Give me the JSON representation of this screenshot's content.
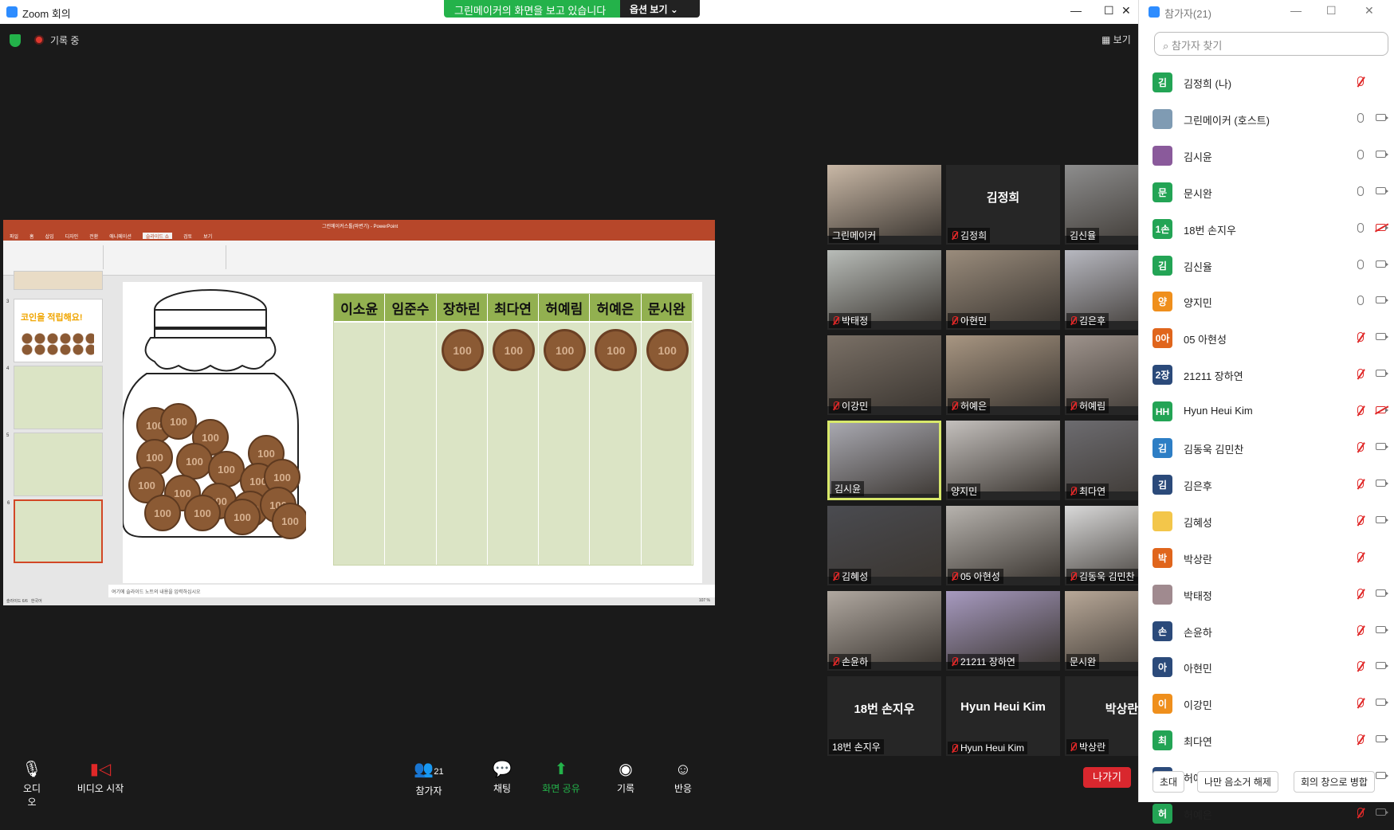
{
  "window": {
    "title": "Zoom 회의",
    "sharing_msg": "그린메이커의 화면을 보고 있습니다",
    "options_label": "옵션 보기"
  },
  "recording": "기록 중",
  "view_label": "보기",
  "ppt": {
    "title": "그린메이커스톨(마변기) - PowerPoint",
    "tabs": [
      "파일",
      "홈",
      "삽입",
      "디자인",
      "전환",
      "애니메이션",
      "슬라이드 쇼",
      "검토",
      "보기"
    ],
    "active_tab": "슬라이드 쇼",
    "slide_titles": {
      "s3": "코인을 적립해요!"
    },
    "notes_placeholder": "여기에 슬라이드 노트의 내용을 입력하십시오",
    "status_left": "슬라이드 6/6",
    "status_lang": "한국어",
    "zoom": "107 %"
  },
  "table_headers": [
    "이소윤",
    "임준수",
    "장하린",
    "최다연",
    "허예림",
    "허예은",
    "문시완"
  ],
  "coin_label": "100",
  "tiles": [
    {
      "name": "그린메이커",
      "muted": false
    },
    {
      "name": "김정희",
      "big": "김정희",
      "muted": true
    },
    {
      "name": "김신율",
      "muted": false
    },
    {
      "name": "박태정",
      "muted": true
    },
    {
      "name": "아현민",
      "muted": true
    },
    {
      "name": "김은후",
      "muted": true
    },
    {
      "name": "이강민",
      "muted": true
    },
    {
      "name": "허예은",
      "muted": true
    },
    {
      "name": "허예림",
      "muted": true
    },
    {
      "name": "김시윤",
      "muted": false
    },
    {
      "name": "양지민",
      "muted": false
    },
    {
      "name": "최다연",
      "muted": true
    },
    {
      "name": "김혜성",
      "muted": true
    },
    {
      "name": "05 아현성",
      "muted": true
    },
    {
      "name": "김동욱 김민찬",
      "muted": true
    },
    {
      "name": "손윤하",
      "muted": true
    },
    {
      "name": "21211 장하연",
      "muted": true
    },
    {
      "name": "문시완",
      "muted": false
    },
    {
      "name": "18번 손지우",
      "big": "18번 손지우",
      "muted": false
    },
    {
      "name": "Hyun Heui Kim",
      "big": "Hyun Heui Kim",
      "muted": true
    },
    {
      "name": "박상란",
      "big": "박상란",
      "muted": true
    }
  ],
  "toolbar": {
    "audio": "오디오",
    "video": "비디오 시작",
    "participants": "참가자",
    "participants_count": "21",
    "chat": "채팅",
    "share": "화면 공유",
    "record": "기록",
    "reactions": "반응",
    "leave": "나가기"
  },
  "panel": {
    "title": "참가자(21)",
    "search_placeholder": "참가자 찾기",
    "participants": [
      {
        "initial": "김",
        "name": "김정희 (나)",
        "color": "#23a455",
        "mic": "off",
        "cam": "none"
      },
      {
        "initial": "",
        "name": "그린메이커 (호스트)",
        "color": "#7f9bb3",
        "mic": "on",
        "cam": "on"
      },
      {
        "initial": "",
        "name": "김시윤",
        "color": "#8a5a9b",
        "mic": "on",
        "cam": "on"
      },
      {
        "initial": "문",
        "name": "문시완",
        "color": "#23a455",
        "mic": "on",
        "cam": "on"
      },
      {
        "initial": "1손",
        "name": "18번 손지우",
        "color": "#23a455",
        "mic": "on",
        "cam": "off"
      },
      {
        "initial": "김",
        "name": "김신율",
        "color": "#23a455",
        "mic": "on",
        "cam": "on"
      },
      {
        "initial": "양",
        "name": "양지민",
        "color": "#ef8f1c",
        "mic": "on",
        "cam": "on"
      },
      {
        "initial": "0아",
        "name": "05 아현성",
        "color": "#e0651c",
        "mic": "off",
        "cam": "on"
      },
      {
        "initial": "2장",
        "name": "21211 장하연",
        "color": "#2b4a7a",
        "mic": "off",
        "cam": "on"
      },
      {
        "initial": "HH",
        "name": "Hyun Heui Kim",
        "color": "#23a455",
        "mic": "off",
        "cam": "off"
      },
      {
        "initial": "김",
        "name": "김동욱 김민찬",
        "color": "#2d7ec5",
        "mic": "off",
        "cam": "on"
      },
      {
        "initial": "김",
        "name": "김은후",
        "color": "#2b4a7a",
        "mic": "off",
        "cam": "on"
      },
      {
        "initial": "",
        "name": "김혜성",
        "color": "#f3c64a",
        "mic": "off",
        "cam": "on"
      },
      {
        "initial": "박",
        "name": "박상란",
        "color": "#e0651c",
        "mic": "off",
        "cam": "none"
      },
      {
        "initial": "",
        "name": "박태정",
        "color": "#a08a8f",
        "mic": "off",
        "cam": "on"
      },
      {
        "initial": "손",
        "name": "손윤하",
        "color": "#2b4a7a",
        "mic": "off",
        "cam": "on"
      },
      {
        "initial": "아",
        "name": "아현민",
        "color": "#2b4a7a",
        "mic": "off",
        "cam": "on"
      },
      {
        "initial": "이",
        "name": "이강민",
        "color": "#ef8f1c",
        "mic": "off",
        "cam": "on"
      },
      {
        "initial": "최",
        "name": "최다연",
        "color": "#23a455",
        "mic": "off",
        "cam": "on"
      },
      {
        "initial": "허",
        "name": "허예림",
        "color": "#2b4a7a",
        "mic": "off",
        "cam": "on"
      },
      {
        "initial": "허",
        "name": "허예은",
        "color": "#23a455",
        "mic": "off",
        "cam": "on"
      }
    ],
    "footer": {
      "invite": "초대",
      "unmute_me": "나만 음소거 해제",
      "merge": "회의 창으로 병합"
    }
  }
}
